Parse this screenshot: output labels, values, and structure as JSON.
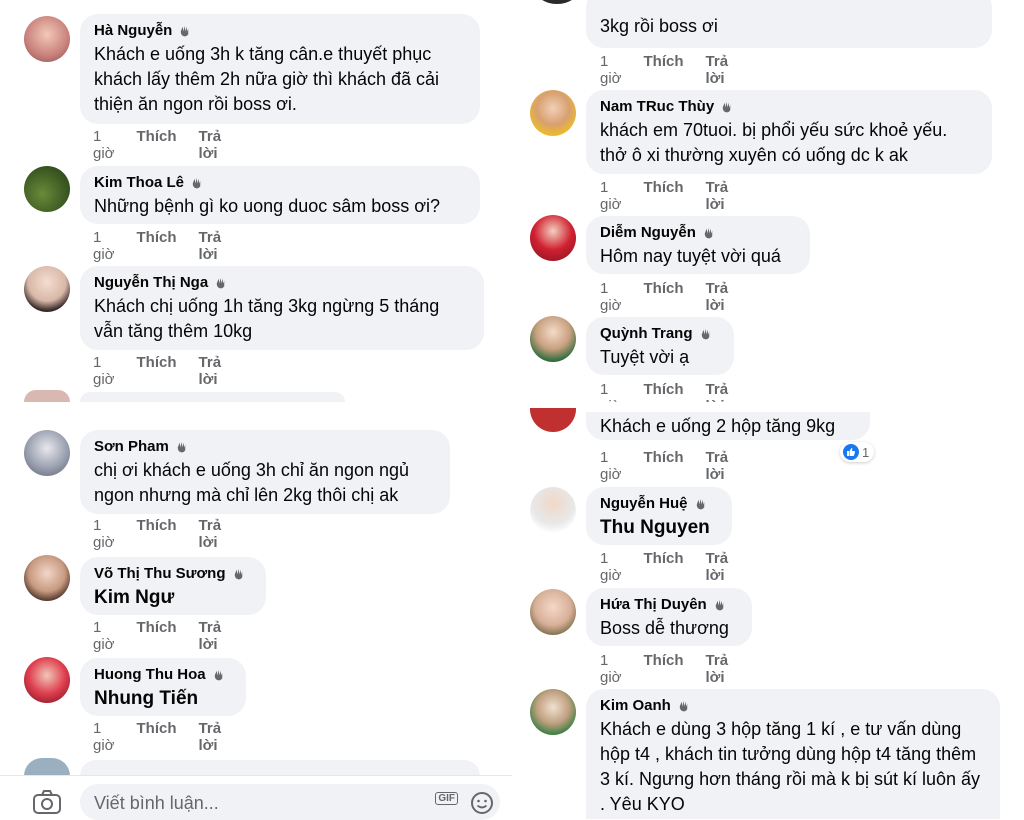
{
  "left_comments": [
    {
      "name": "Hà Nguyễn",
      "text": "Khách e uống 3h k tăng cân.e thuyết phục khách lấy thêm 2h nữa giờ thì khách đã cải thiện ăn ngon rồi boss ơi.",
      "time": "1 giờ",
      "like": "Thích",
      "reply": "Trả lời"
    },
    {
      "name": "Kim Thoa Lê",
      "text": "Những bệnh gì ko uong duoc sâm boss ơi?",
      "time": "1 giờ",
      "like": "Thích",
      "reply": "Trả lời"
    },
    {
      "name": "Nguyễn Thị Nga",
      "text": "Khách chị uống 1h tăng 3kg ngừng 5 tháng vẫn tăng thêm 10kg",
      "time": "1 giờ",
      "like": "Thích",
      "reply": "Trả lời"
    },
    {
      "name": "Sơn Pham",
      "text": "chị ơi khách e uống 3h chỉ ăn ngon ngủ ngon nhưng mà chỉ lên 2kg thôi chị ak",
      "time": "1 giờ",
      "like": "Thích",
      "reply": "Trả lời"
    },
    {
      "name": "Võ Thị Thu Sương",
      "tag": "Kim Ngư",
      "time": "1 giờ",
      "like": "Thích",
      "reply": "Trả lời"
    },
    {
      "name": "Huong Thu Hoa",
      "tag": "Nhung Tiến",
      "time": "1 giờ",
      "like": "Thích",
      "reply": "Trả lời"
    }
  ],
  "right_comments": [
    {
      "text": "3kg rồi boss ơi",
      "time": "1 giờ",
      "like": "Thích",
      "reply": "Trả lời"
    },
    {
      "name": "Nam TRuc Thùy",
      "text": "khách em 70tuoi. bị phổi yếu sức khoẻ yếu. thở ô xi thường xuyên có uống dc k ak",
      "time": "1 giờ",
      "like": "Thích",
      "reply": "Trả lời"
    },
    {
      "name": "Diễm Nguyễn",
      "text": "Hôm nay tuyệt vời quá",
      "time": "1 giờ",
      "like": "Thích",
      "reply": "Trả lời"
    },
    {
      "name": "Quỳnh Trang",
      "text": "Tuyệt vời ạ",
      "time": "1 giờ",
      "like": "Thích",
      "reply": "Trả lời"
    },
    {
      "text": "Khách e uống 2 hộp tăng 9kg",
      "time": "1 giờ",
      "like": "Thích",
      "reply": "Trả lời",
      "reactions": "1"
    },
    {
      "name": "Nguyễn Huệ",
      "tag": "Thu Nguyen",
      "time": "1 giờ",
      "like": "Thích",
      "reply": "Trả lời"
    },
    {
      "name": "Hứa Thị Duyên",
      "text": "Boss dễ thương",
      "time": "1 giờ",
      "like": "Thích",
      "reply": "Trả lời"
    },
    {
      "name": "Kim Oanh",
      "text": "Khách e dùng 3 hộp tăng 1 kí , e tư vấn dùng hộp t4 , khách tin tưởng dùng hộp t4 tăng thêm 3 kí. Ngưng hơn tháng rồi mà k bị sút kí luôn ấy . Yêu KYO"
    }
  ],
  "composer": {
    "placeholder": "Viết bình luận...",
    "gif": "GIF"
  },
  "colors": {
    "bubble": "#f0f2f5",
    "meta": "#65676b",
    "like": "#1877f2"
  }
}
